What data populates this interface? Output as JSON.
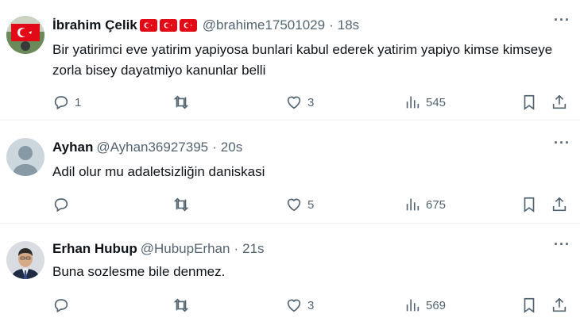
{
  "tweets": [
    {
      "name": "İbrahim Çelik",
      "handle": "@brahime17501029",
      "dot": "·",
      "time": "18s",
      "text": "Bir yatirimci eve yatirim yapiyosa bunlari kabul ederek yatirim yapiyo kimse kimseye zorla bisey dayatmiyo kanunlar belli",
      "replies": "1",
      "retweets": "",
      "likes": "3",
      "views": "545"
    },
    {
      "name": "Ayhan",
      "handle": "@Ayhan36927395",
      "dot": "·",
      "time": "20s",
      "text": "Adil olur mu adaletsizliğin daniskasi",
      "replies": "",
      "retweets": "",
      "likes": "5",
      "views": "675"
    },
    {
      "name": "Erhan Hubup",
      "handle": "@HubupErhan",
      "dot": "·",
      "time": "21s",
      "text": "Buna sozlesme bile denmez.",
      "replies": "",
      "retweets": "",
      "likes": "3",
      "views": "569"
    }
  ],
  "more_label": "···",
  "colors": {
    "text": "#0f1419",
    "muted": "#536471",
    "flag_red": "#e30a17",
    "divider": "#eff3f4"
  },
  "icons": [
    "reply-icon",
    "retweet-icon",
    "heart-icon",
    "views-icon",
    "bookmark-icon",
    "share-icon",
    "more-icon",
    "turkish-flag-icon"
  ]
}
